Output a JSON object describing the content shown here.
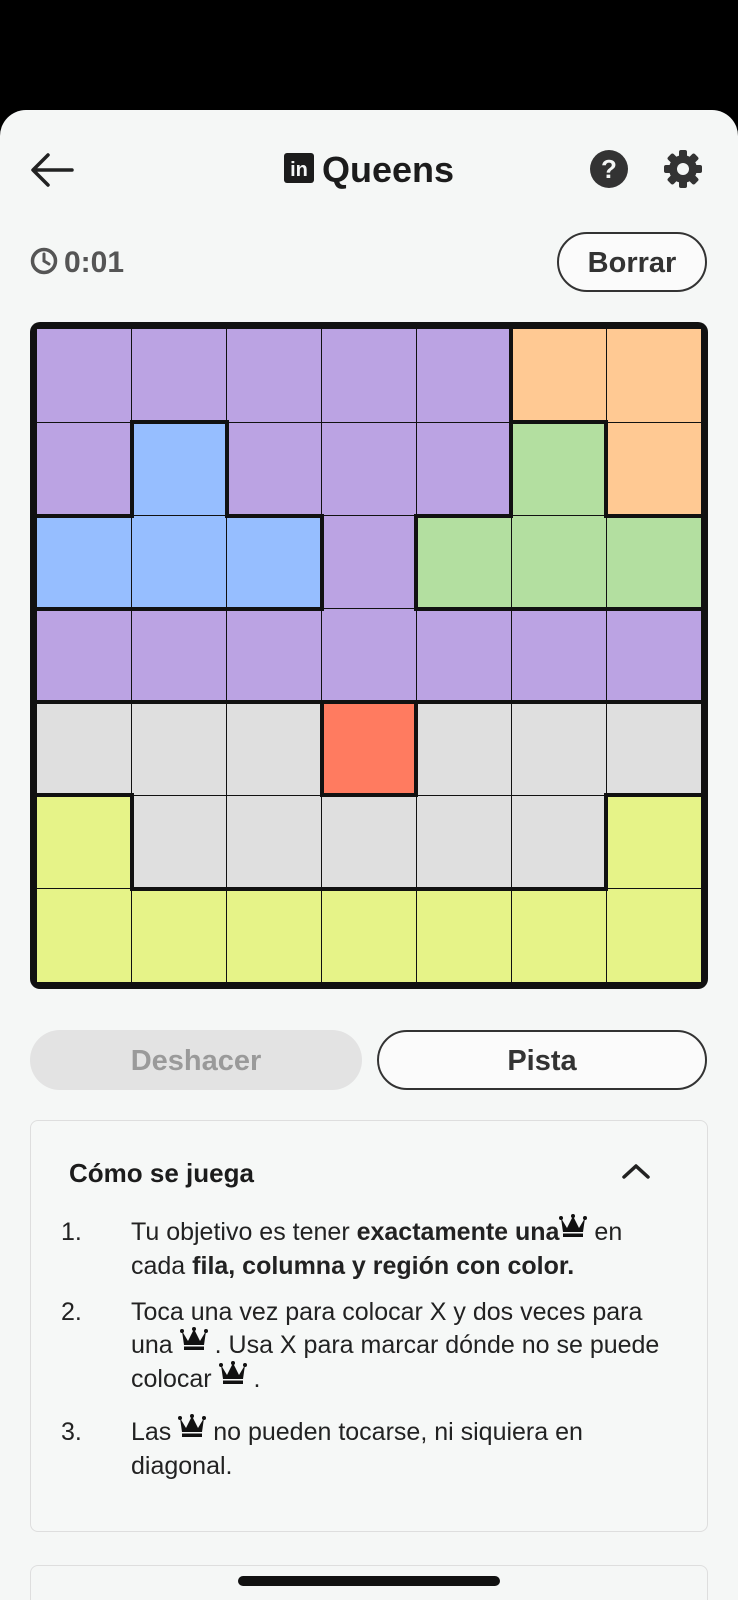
{
  "header": {
    "title": "Queens",
    "logo_text": "in"
  },
  "timer": {
    "value": "0:01"
  },
  "buttons": {
    "clear": "Borrar",
    "undo": "Deshacer",
    "hint": "Pista"
  },
  "colors": {
    "purple": "#bba3e3",
    "orange": "#ffc993",
    "blue": "#96beff",
    "green": "#b3dfa0",
    "gray": "#dfdfdf",
    "red": "#ff7b60",
    "yellow": "#e6f388"
  },
  "board": {
    "size": 7,
    "regions": [
      [
        "purple",
        "purple",
        "purple",
        "purple",
        "purple",
        "orange",
        "orange"
      ],
      [
        "purple",
        "blue",
        "purple",
        "purple",
        "purple",
        "green",
        "orange"
      ],
      [
        "blue",
        "blue",
        "blue",
        "purple",
        "green",
        "green",
        "green"
      ],
      [
        "purple",
        "purple",
        "purple",
        "purple",
        "purple",
        "purple",
        "purple"
      ],
      [
        "gray",
        "gray",
        "gray",
        "red",
        "gray",
        "gray",
        "gray"
      ],
      [
        "yellow",
        "gray",
        "gray",
        "gray",
        "gray",
        "gray",
        "yellow"
      ],
      [
        "yellow",
        "yellow",
        "yellow",
        "yellow",
        "yellow",
        "yellow",
        "yellow"
      ]
    ]
  },
  "instructions": {
    "title": "Cómo se juega",
    "rules": [
      {
        "num": "1.",
        "parts": [
          {
            "t": "Tu objetivo es tener "
          },
          {
            "t": "exactamente una",
            "b": true
          },
          {
            "icon": "crown-icon"
          },
          {
            "t": " en cada "
          },
          {
            "t": "fila, columna y región con color.",
            "b": true
          }
        ]
      },
      {
        "num": "2.",
        "parts": [
          {
            "t": "Toca una vez para colocar X y dos veces para una "
          },
          {
            "icon": "crown-icon"
          },
          {
            "t": " . Usa X para marcar dónde no se puede colocar "
          },
          {
            "icon": "crown-icon"
          },
          {
            "t": " ."
          }
        ]
      },
      {
        "num": "3.",
        "parts": [
          {
            "t": "Las "
          },
          {
            "icon": "crown-icon"
          },
          {
            "t": " no pueden tocarse, ni siquiera en diagonal."
          }
        ]
      }
    ]
  }
}
